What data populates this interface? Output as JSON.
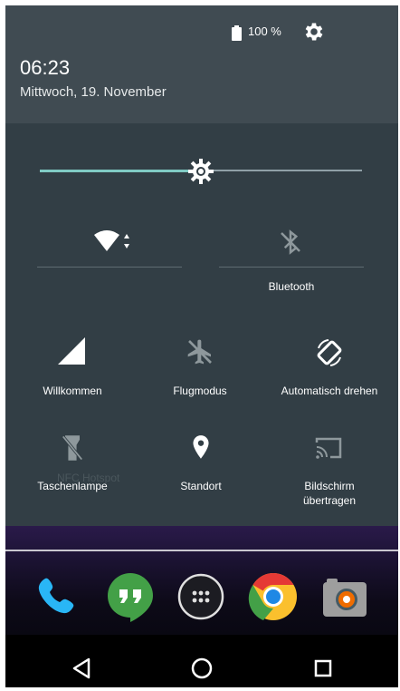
{
  "status": {
    "battery_text": "100 %",
    "icons": [
      "battery-icon",
      "gear-icon"
    ]
  },
  "header": {
    "time": "06:23",
    "date": "Mittwoch, 19. November"
  },
  "brightness": {
    "level": 0.5
  },
  "tiles": {
    "row1": [
      {
        "label": "",
        "icon": "wifi-icon"
      },
      {
        "label": "Bluetooth",
        "icon": "bluetooth-off-icon"
      }
    ],
    "row2": [
      {
        "label": "Willkommen",
        "icon": "signal-icon"
      },
      {
        "label": "Flugmodus",
        "icon": "airplane-off-icon"
      },
      {
        "label": "Automatisch drehen",
        "icon": "auto-rotate-icon"
      }
    ],
    "row3": [
      {
        "label": "Taschenlampe",
        "icon": "flashlight-off-icon"
      },
      {
        "label": "Standort",
        "icon": "location-icon"
      },
      {
        "label_line1": "Bildschirm",
        "label_line2": "übertragen",
        "icon": "cast-icon"
      }
    ]
  },
  "background_text": "NFC Hotspot",
  "dock": [
    "phone-icon",
    "hangouts-icon",
    "app-drawer-icon",
    "chrome-icon",
    "camera-icon"
  ],
  "navbar": [
    "back-icon",
    "home-icon",
    "recents-icon"
  ],
  "colors": {
    "header": "#404b52",
    "panel": "#323e45",
    "accent": "#80cbc4"
  }
}
